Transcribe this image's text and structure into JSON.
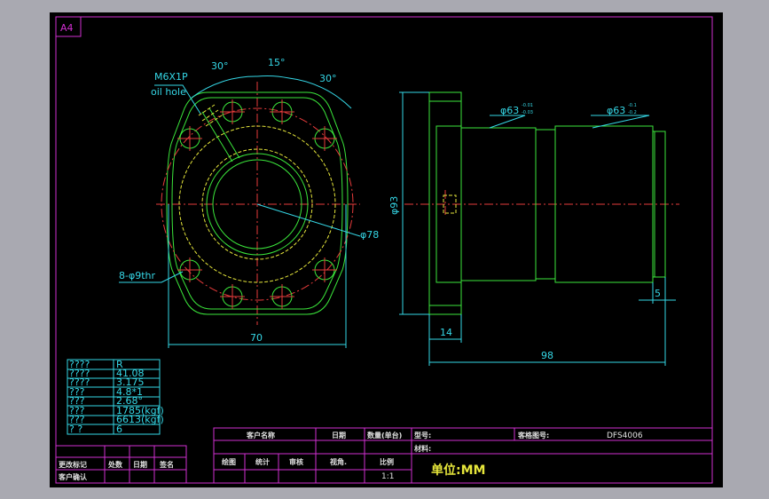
{
  "sheet": {
    "size_label": "A4"
  },
  "drawing": {
    "front_view": {
      "thread_label": "M6X1P",
      "oil_hole_label": "oil hole",
      "angle_top_left": "30°",
      "angle_top_mid": "15°",
      "angle_top_right": "30°",
      "bolt_circle_dim": "φ78",
      "holes_label": "8-φ9thr",
      "width_dim": "70"
    },
    "side_view": {
      "diameter_1": "φ63",
      "diameter_1_tol_upper": "-0.01",
      "diameter_1_tol_lower": "-0.03",
      "diameter_2": "φ63",
      "diameter_2_tol_upper": "-0.1",
      "diameter_2_tol_lower": "-0.2",
      "flange_dia": "φ93",
      "flange_thickness": "14",
      "total_length": "98",
      "end_width": "5"
    }
  },
  "spec_table": {
    "rows": [
      {
        "k": "????",
        "v": "R"
      },
      {
        "k": "????",
        "v": "41.08"
      },
      {
        "k": "????",
        "v": "3.175"
      },
      {
        "k": " ???",
        "v": "4.8*1"
      },
      {
        "k": " ???",
        "v": "2.68°"
      },
      {
        "k": " ???",
        "v": "1785(kgf)"
      },
      {
        "k": " ???",
        "v": "6613(kgf)"
      },
      {
        "k": " ?  ?",
        "v": "6"
      }
    ]
  },
  "title_block": {
    "customer_name": "客户名称",
    "date": "日期",
    "quantity": "数量(单台)",
    "model": "型号:",
    "customer_drawing_no": "客格图号:",
    "drawing_no_value": "DFS4006",
    "material": "材料:",
    "drawn": "绘图",
    "stat": "统计",
    "review": "审核",
    "approve": "视角.",
    "scale_label": "比例",
    "scale_value": "1:1",
    "unit": "单位:MM"
  },
  "revision_block": {
    "change_mark": "更改标记",
    "location": "处数",
    "date": "日期",
    "sign": "签名",
    "customer_confirm": "客户确认"
  }
}
